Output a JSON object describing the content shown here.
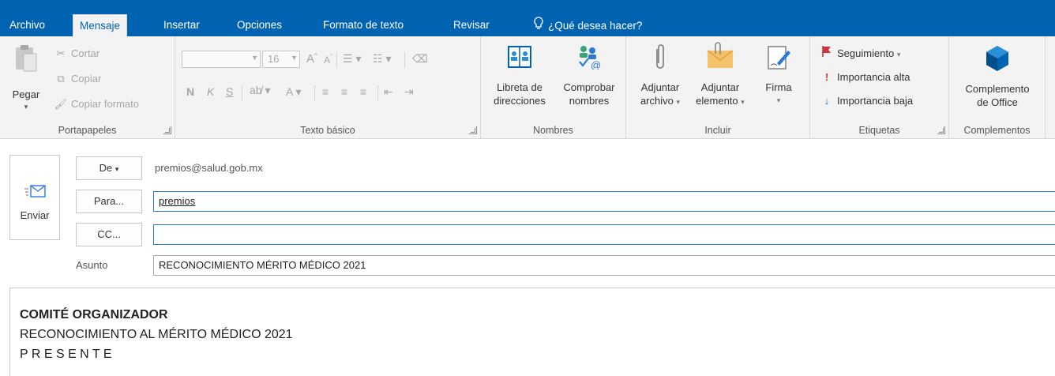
{
  "tabs": [
    "Archivo",
    "Mensaje",
    "Insertar",
    "Opciones",
    "Formato de texto",
    "Revisar"
  ],
  "tell_me": "¿Qué desea hacer?",
  "ribbon": {
    "clipboard": {
      "paste": "Pegar",
      "cut": "Cortar",
      "copy": "Copiar",
      "format_painter": "Copiar formato",
      "label": "Portapapeles"
    },
    "basic_text": {
      "font_size": "16",
      "bold": "N",
      "italic": "K",
      "underline": "S",
      "grow": "A",
      "shrink": "A",
      "font_color": "A",
      "label": "Texto básico"
    },
    "names": {
      "address_book_l1": "Libreta de",
      "address_book_l2": "direcciones",
      "check_names_l1": "Comprobar",
      "check_names_l2": "nombres",
      "label": "Nombres"
    },
    "include": {
      "attach_file_l1": "Adjuntar",
      "attach_file_l2": "archivo",
      "attach_item_l1": "Adjuntar",
      "attach_item_l2": "elemento",
      "signature": "Firma",
      "label": "Incluir"
    },
    "tags": {
      "follow_up": "Seguimiento",
      "high_importance": "Importancia alta",
      "low_importance": "Importancia baja",
      "label": "Etiquetas"
    },
    "addins": {
      "office_addin_l1": "Complemento",
      "office_addin_l2": "de Office",
      "label": "Complementos"
    }
  },
  "compose": {
    "send": "Enviar",
    "from_button": "De",
    "from_value": "premios@salud.gob.mx",
    "to_button": "Para...",
    "to_value": "premios",
    "cc_button": "CC...",
    "cc_value": "",
    "subject_label": "Asunto",
    "subject_value": "RECONOCIMIENTO MÉRITO MÉDICO 2021"
  },
  "body": {
    "line1": "COMITÉ ORGANIZADOR",
    "line2": "RECONOCIMIENTO AL MÉRITO MÉDICO 2021",
    "line3": "P R E S E N T E"
  },
  "colors": {
    "accent": "#0063b1",
    "ribbon_bg": "#f3f3f3",
    "flag_red": "#d13438",
    "low_importance_blue": "#2b6cc4"
  }
}
